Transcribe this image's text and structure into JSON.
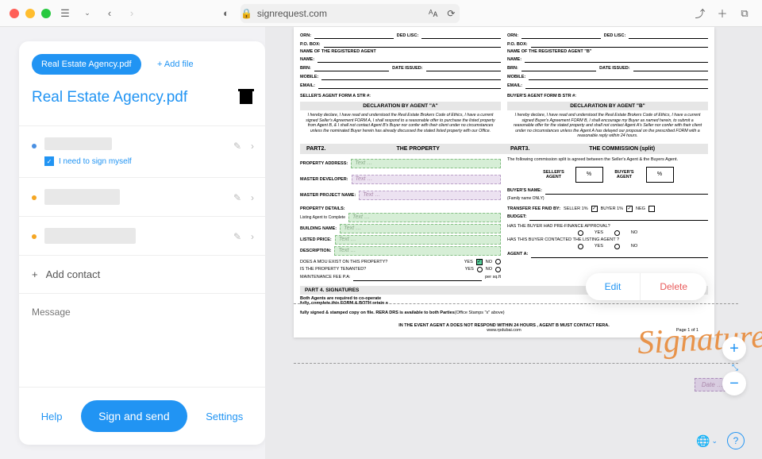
{
  "browser": {
    "url": "signrequest.com"
  },
  "sidebar": {
    "doc_pill": "Real Estate Agency.pdf",
    "add_file": "+ Add file",
    "doc_title": "Real Estate Agency.pdf",
    "self_sign": "I need to sign myself",
    "add_contact": "Add contact",
    "message_ph": "Message",
    "help": "Help",
    "sign": "Sign and send",
    "settings": "Settings"
  },
  "doc": {
    "orn": "ORN:",
    "ded": "DED LISC:",
    "pobox": "P.O. BOX:",
    "agent_a_name": "NAME OF THE REGISTERED AGENT",
    "agent_b_name": "NAME OF THE REGISTERED AGENT \"B\"",
    "name": "NAME:",
    "brn": "BRN:",
    "issued": "DATE ISSUED:",
    "mobile": "MOBILE:",
    "email": "EMAIL:",
    "seller_str": "SELLER'S AGENT FORM A STR #:",
    "buyer_str": "BUYER'S AGENT FORM B STR #:",
    "decl_a": "DECLARATION BY AGENT \"A\"",
    "decl_b": "DECLARATION BY AGENT \"B\"",
    "decl_a_txt": "I hereby declare, I have read and understood the Real Estate Brokers Code of Ethics, I have a current signed Seller's Agreement FORM A, I shall respond to a reasonable offer to purchase the listed property from Agent B, & I shall not contact Agent B's Buyer nor confer with their client under no circumstances unless the nominated Buyer herein has already discussed the stated listed property with our Office.",
    "decl_b_txt": "I hereby declare, I have read and understood the Real Estate Brokers Code of Ethics, I have a current signed Buyer's Agreement FORM B, I shall encourage my Buyer as named herein, to submit a reasonable offer for the stated property and shall not contact Agent A's Seller nor confer with their client under no circumstances unless the Agent A has delayed our proposal on the prescribed FORM with a reasonable reply within 24 hours.",
    "part2": "PART2.",
    "property": "THE PROPERTY",
    "part3": "PART3.",
    "commission": "THE COMMISSION (split)",
    "prop_addr": "PROPERTY ADDRESS:",
    "master_dev": "MASTER DEVELOPER:",
    "master_proj": "MASTER PROJECT NAME:",
    "comm_txt": "The following commission split is agreed between the Seller's Agent & the Buyers Agent.",
    "sellers_agent": "SELLER'S AGENT",
    "buyers_agent": "BUYER'S AGENT",
    "pct": "%",
    "buyer_name": "BUYER'S NAME:",
    "family": "(Family name ONLY)",
    "prop_details": "PROPERTY  DETAILS:",
    "listing_agent": "Listing Agent to Complete",
    "building": "BUILDING NAME:",
    "listed_price": "LISTED PRICE:",
    "description": "DESCRIPTION:",
    "transfer": "TRANSFER FEE  PAID BY:",
    "seller1": "SELLER 1%",
    "buyer1": "BUYER 1%",
    "neg": "NEG",
    "budget": "BUDGET:",
    "prefinance": "HAS THE BUYER HAD PRE-FINANCE APPROVAL?",
    "mou": "DOES A MOU EXIST ON THIS PROPERTY?",
    "tenanted": "IS THE PROPERTY TENANTED?",
    "maint": "MAINTENANCE FEE P.A:",
    "persqft": "per sq.ft",
    "contacted": "HAS THIS BUYER CONTACTED THE LISTING AGENT ?",
    "agent_a_lbl": "AGENT A:",
    "yes": "YES",
    "no": "NO",
    "part4": "PART 4. SIGNATURES",
    "both": "Both Agents are required to co-operate",
    "fully": "fully, complete this FORM & BOTH retain a",
    "signed": "fully signed & stamped copy on file. RERA DRS is available to both Parties",
    "stamps": "(Office Stamps \"x\" above)",
    "event": "IN THE EVENT AGENT A DOES NOT RESPOND WITHIN 24 HOURS , AGENT B MUST CONTACT RERA.",
    "rpd": "www.rpdubai.com",
    "page": "Page 1 of 1",
    "text_ph": "Text …",
    "date_ph": "Date …"
  },
  "popup": {
    "edit": "Edit",
    "delete": "Delete"
  },
  "signature": "Signature"
}
